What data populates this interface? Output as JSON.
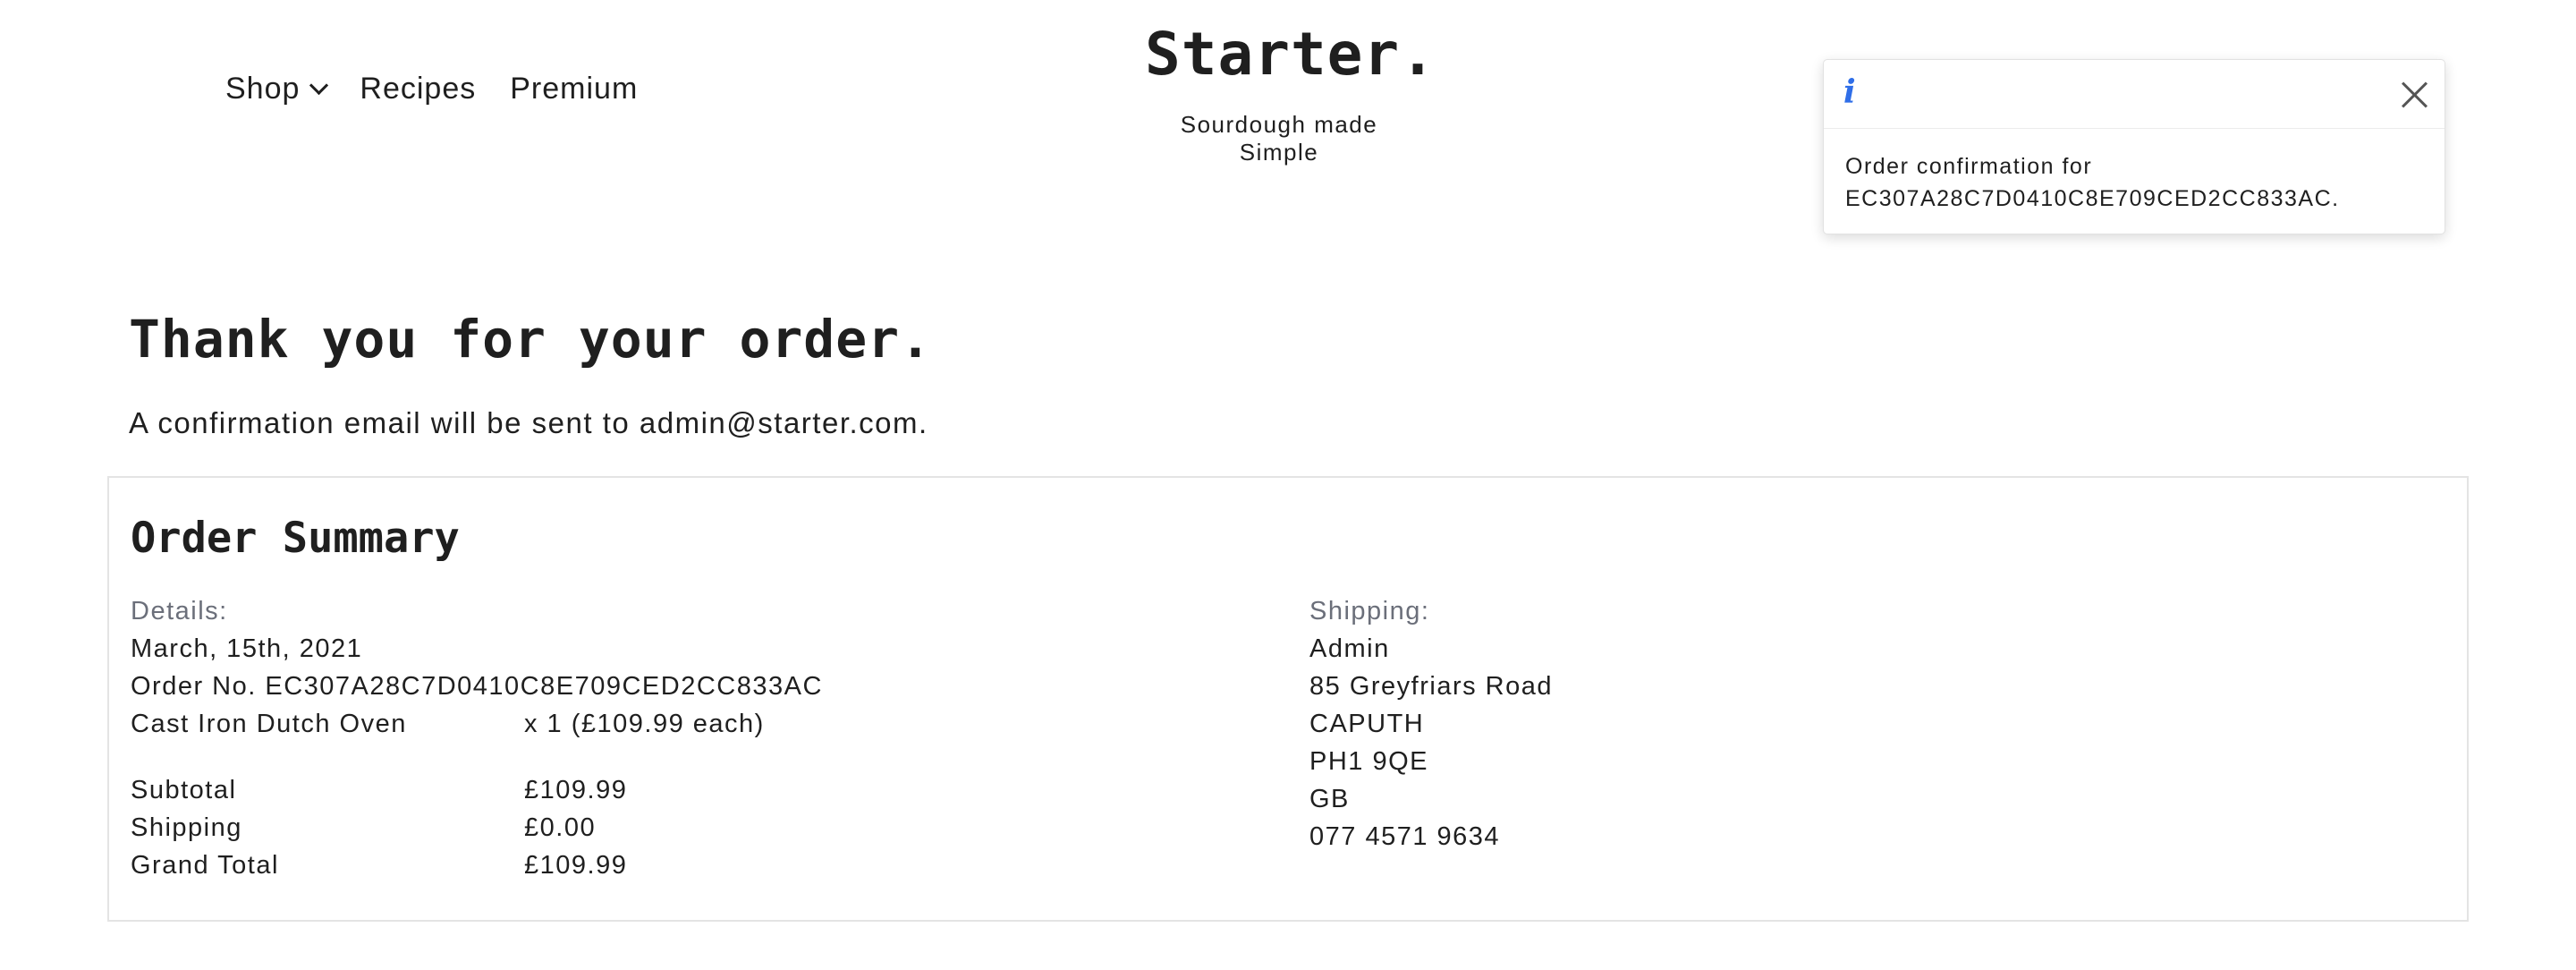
{
  "nav": {
    "items": [
      {
        "label": "Shop",
        "has_dropdown": true
      },
      {
        "label": "Recipes"
      },
      {
        "label": "Premium"
      }
    ]
  },
  "brand": {
    "title": "Starter.",
    "tagline": "Sourdough made Simple"
  },
  "toast": {
    "icon": "info-icon",
    "message_line1": "Order confirmation for",
    "message_line2": "EC307A28C7D0410C8E709CED2CC833AC.",
    "close_icon": "close-icon",
    "accent_color": "#2f6ee8"
  },
  "page": {
    "heading": "Thank you for your order.",
    "confirm_prefix": "A confirmation email will be sent to ",
    "email": "admin@starter.com",
    "confirm_suffix": "."
  },
  "summary": {
    "title": "Order Summary",
    "details": {
      "label": "Details:",
      "date": "March, 15th, 2021",
      "order_no": "Order No. EC307A28C7D0410C8E709CED2CC833AC",
      "items": [
        {
          "name": "Cast Iron Dutch Oven",
          "qty_price": "x 1 (£109.99 each)"
        }
      ],
      "totals": [
        {
          "label": "Subtotal",
          "value": "£109.99"
        },
        {
          "label": "Shipping",
          "value": "£0.00"
        },
        {
          "label": "Grand Total",
          "value": "£109.99"
        }
      ]
    },
    "shipping": {
      "label": "Shipping:",
      "lines": [
        "Admin",
        "85 Greyfriars Road",
        "CAPUTH",
        "PH1 9QE",
        "GB",
        "077 4571 9634"
      ]
    }
  }
}
